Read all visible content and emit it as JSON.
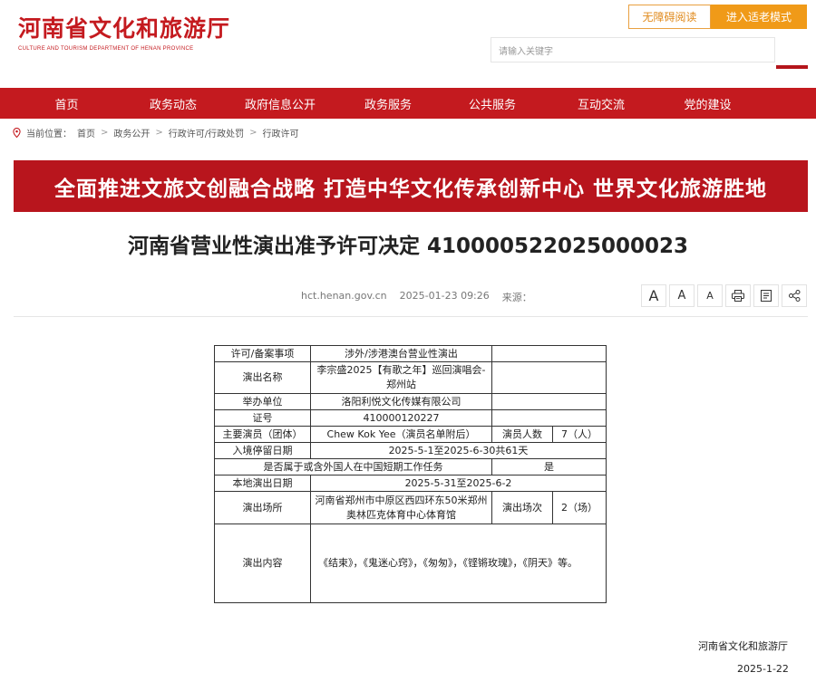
{
  "header": {
    "logo_cn": "河南省文化和旅游厅",
    "logo_en": "CULTURE AND TOURISM DEPARTMENT OF HENAN PROVINCE",
    "accessibility_btn": "无障碍阅读",
    "elder_mode_btn": "进入适老模式",
    "search_placeholder": "请输入关键字"
  },
  "nav": {
    "items": [
      "首页",
      "政务动态",
      "政府信息公开",
      "政务服务",
      "公共服务",
      "互动交流",
      "党的建设"
    ]
  },
  "breadcrumb": {
    "prefix": "当前位置：",
    "items": [
      "首页",
      "政务公开",
      "行政许可/行政处罚",
      "行政许可"
    ],
    "separator": ">"
  },
  "banner": {
    "text": "全面推进文旅文创融合战略  打造中华文化传承创新中心  世界文化旅游胜地"
  },
  "article": {
    "title": "河南省营业性演出准予许可决定  410000522025000023",
    "source_site": "hct.henan.gov.cn",
    "datetime": "2025-01-23 09:26",
    "source_label": "来源：",
    "font_large": "A",
    "font_medium": "A",
    "font_small": "A"
  },
  "table": {
    "permit_type_label": "许可/备案事项",
    "permit_type_value": "涉外/涉港澳台营业性演出",
    "show_name_label": "演出名称",
    "show_name_value": "李宗盛2025【有歌之年】巡回演唱会-郑州站",
    "organizer_label": "举办单位",
    "organizer_value": "洛阳利悦文化传媒有限公司",
    "license_label": "证号",
    "license_value": "410000120227",
    "performer_label": "主要演员（团体）",
    "performer_value": "Chew Kok Yee（演员名单附后）",
    "performer_count_label": "演员人数",
    "performer_count_value": "7（人）",
    "stay_label": "入境停留日期",
    "stay_value": "2025-5-1至2025-6-30共61天",
    "short_term_label": "是否属于或含外国人在中国短期工作任务",
    "short_term_value": "是",
    "local_date_label": "本地演出日期",
    "local_date_value": "2025-5-31至2025-6-2",
    "venue_label": "演出场所",
    "venue_value": "河南省郑州市中原区西四环东50米郑州奥林匹克体育中心体育馆",
    "session_label": "演出场次",
    "session_value": "2（场）",
    "content_label": "演出内容",
    "content_value": "《结束》，《鬼迷心窍》，《匆匆》，《铿锵玫瑰》，《阴天》等。"
  },
  "signature": {
    "org": "河南省文化和旅游厅",
    "date": "2025-1-22"
  },
  "colors": {
    "brand_red": "#c41a1f",
    "banner_red": "#b8151d",
    "orange": "#f09a18"
  }
}
